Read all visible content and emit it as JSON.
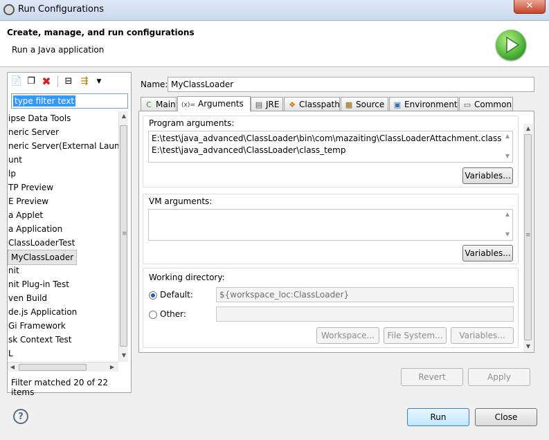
{
  "window": {
    "title": "Run Configurations",
    "close_glyph": "✕"
  },
  "header": {
    "title": "Create, manage, and run configurations",
    "subtitle": "Run a Java application"
  },
  "left": {
    "filter_text": "type filter text",
    "items": [
      "ipse Data Tools",
      "neric Server",
      "neric Server(External Launc",
      "unt",
      "lp",
      "TP Preview",
      "E Preview",
      "a Applet",
      "a Application",
      "ClassLoaderTest",
      "MyClassLoader",
      "nit",
      "nit Plug-in Test",
      "ven Build",
      "de.js Application",
      "Gi Framework",
      "sk Context Test",
      "L"
    ],
    "selected_index": 10,
    "status": "Filter matched 20 of 22 items"
  },
  "name": {
    "label": "Name:",
    "value": "MyClassLoader"
  },
  "tabs": [
    {
      "label": "Main",
      "icon": "main-icon",
      "glyph": "C",
      "color": "#2a9a2a"
    },
    {
      "label": "Arguments",
      "icon": "arguments-icon",
      "glyph": "(x)=",
      "color": "#333333"
    },
    {
      "label": "JRE",
      "icon": "jre-icon",
      "glyph": "▤",
      "color": "#555555"
    },
    {
      "label": "Classpath",
      "icon": "classpath-icon",
      "glyph": "❖",
      "color": "#c07a00"
    },
    {
      "label": "Source",
      "icon": "source-icon",
      "glyph": "▦",
      "color": "#8a6a00"
    },
    {
      "label": "Environment",
      "icon": "environment-icon",
      "glyph": "▣",
      "color": "#3a6aa8"
    },
    {
      "label": "Common",
      "icon": "common-icon",
      "glyph": "▭",
      "color": "#555555"
    }
  ],
  "active_tab": 1,
  "arguments": {
    "program_label": "Program arguments:",
    "program_lines": [
      "E:\\test\\java_advanced\\ClassLoader\\bin\\com\\mazaiting\\ClassLoaderAttachment.class",
      "E:\\test\\java_advanced\\ClassLoader\\class_temp"
    ],
    "variables_label": "Variables...",
    "vm_label": "VM arguments:",
    "vm_value": "",
    "working_dir_label": "Working directory:",
    "default_label": "Default:",
    "default_value": "${workspace_loc:ClassLoader}",
    "other_label": "Other:",
    "other_value": "",
    "workspace_label": "Workspace...",
    "file_system_label": "File System..."
  },
  "footer": {
    "revert": "Revert",
    "apply": "Apply",
    "run": "Run",
    "close": "Close",
    "help_glyph": "?"
  },
  "colors": {
    "selection": "#3399ff",
    "run_green": "#3aa52a"
  }
}
